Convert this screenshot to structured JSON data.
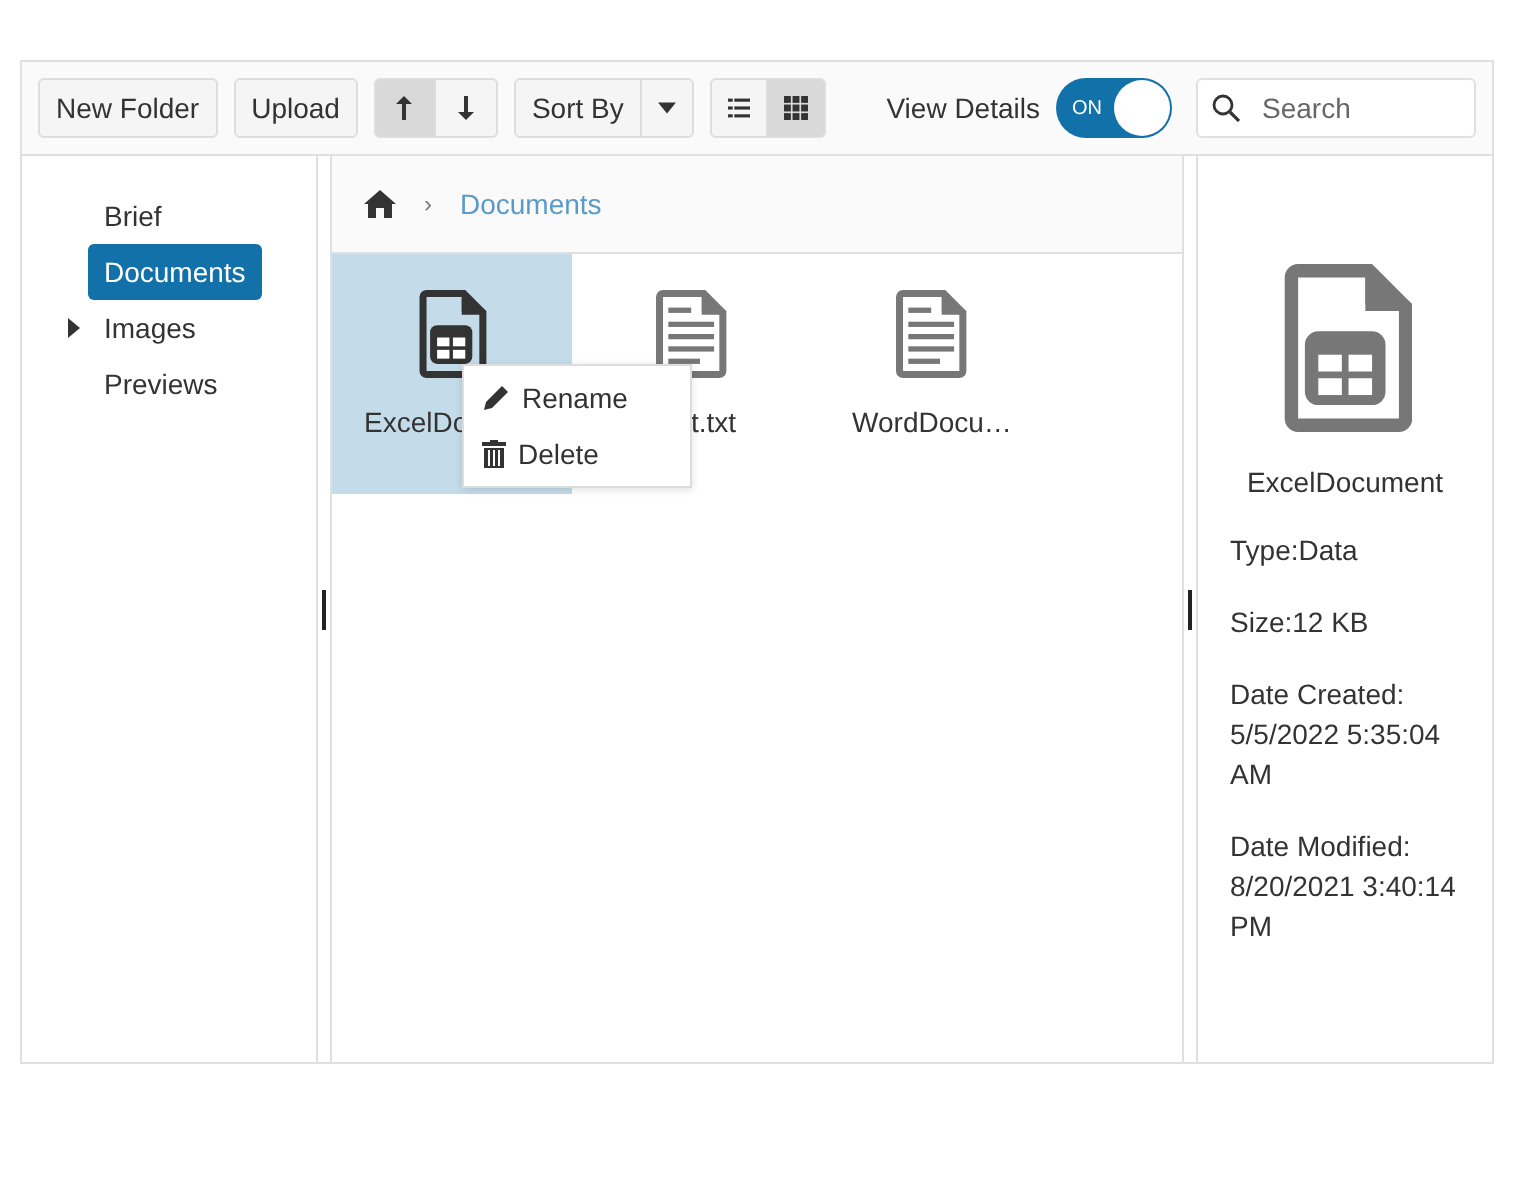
{
  "toolbar": {
    "buttons": [
      {
        "label": "New Folder"
      },
      {
        "label": "Upload"
      }
    ],
    "sort_order": [
      {
        "kind": "ascending",
        "selected": true
      },
      {
        "kind": "descending",
        "selected": false
      }
    ],
    "sort_by": {
      "label": "Sort By"
    },
    "views": [
      {
        "kind": "list",
        "selected": false
      },
      {
        "kind": "grid",
        "selected": true
      }
    ],
    "view_details": {
      "label": "View Details",
      "on": true,
      "state_text": "ON"
    },
    "search": {
      "placeholder": "Search"
    }
  },
  "tree": [
    {
      "label": "Brief",
      "selected": false
    },
    {
      "label": "Documents",
      "selected": true
    },
    {
      "label": "Images",
      "selected": false,
      "expanded": false
    },
    {
      "label": "Previews",
      "selected": false
    }
  ],
  "breadcrumb": [
    {
      "separator": "›",
      "label": "Documents"
    }
  ],
  "files": [
    {
      "kind": "sheet",
      "name": "ExcelDo",
      "selected": true
    },
    {
      "kind": "text",
      "name": "t.txt",
      "selected": false
    },
    {
      "kind": "text",
      "name": "WordDocu…",
      "selected": false
    }
  ],
  "context_menu": [
    {
      "kind": "rename",
      "label": "Rename"
    },
    {
      "kind": "delete",
      "label": "Delete"
    }
  ],
  "details": {
    "kind": "sheet",
    "name": "ExcelDocument",
    "lines": [
      "Type:Data",
      "Size:12 KB",
      "Date Created: 5/5/2022 5:35:04 AM",
      "Date Modified: 8/20/2021 3:40:14 PM"
    ]
  }
}
